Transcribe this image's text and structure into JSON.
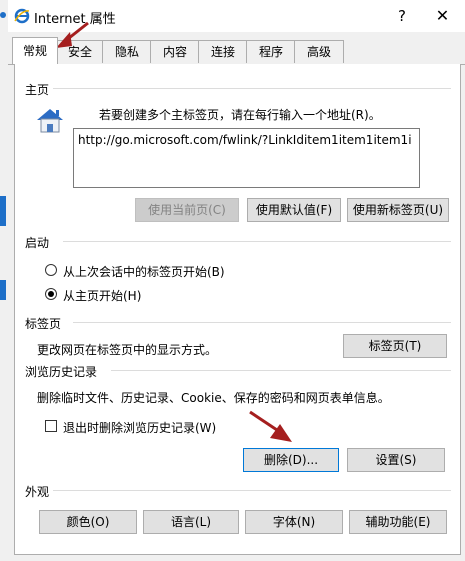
{
  "window": {
    "title": "Internet 属性",
    "help_glyph": "?",
    "close_glyph": "✕"
  },
  "tabs": [
    {
      "label": "常规",
      "active": true
    },
    {
      "label": "安全"
    },
    {
      "label": "隐私"
    },
    {
      "label": "内容"
    },
    {
      "label": "连接"
    },
    {
      "label": "程序"
    },
    {
      "label": "高级"
    }
  ],
  "homepage": {
    "section_label": "主页",
    "instruction": "若要创建多个主标签页，请在每行输入一个地址(R)。",
    "url_value": "http://go.microsoft.com/fwlink/?LinkIditem1item1item1i",
    "buttons": {
      "use_current": "使用当前页(C)",
      "use_default": "使用默认值(F)",
      "use_new_tab": "使用新标签页(U)"
    }
  },
  "startup": {
    "section_label": "启动",
    "option_last_session": "从上次会话中的标签页开始(B)",
    "option_homepage": "从主页开始(H)",
    "selected": "option_homepage"
  },
  "tabs_section": {
    "section_label": "标签页",
    "description": "更改网页在标签页中的显示方式。",
    "button": "标签页(T)"
  },
  "history": {
    "section_label": "浏览历史记录",
    "description": "删除临时文件、历史记录、Cookie、保存的密码和网页表单信息。",
    "checkbox_label": "退出时删除浏览历史记录(W)",
    "checkbox_checked": false,
    "delete_button": "删除(D)...",
    "settings_button": "设置(S)"
  },
  "appearance": {
    "section_label": "外观",
    "colors_button": "颜色(O)",
    "languages_button": "语言(L)",
    "fonts_button": "字体(N)",
    "accessibility_button": "辅助功能(E)"
  },
  "colors": {
    "annotation_arrow": "#a51f1f",
    "focus": "#0078d7",
    "ie_blue": "#1e6fc8"
  }
}
